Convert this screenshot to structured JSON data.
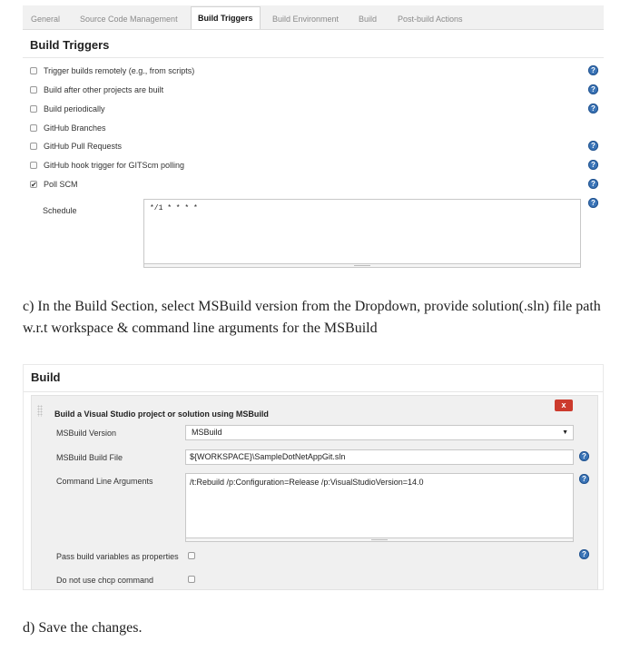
{
  "tabs": [
    "General",
    "Source Code Management",
    "Build Triggers",
    "Build Environment",
    "Build",
    "Post-build Actions"
  ],
  "active_tab": "Build Triggers",
  "build_triggers": {
    "title": "Build Triggers",
    "options": [
      {
        "label": "Trigger builds remotely (e.g., from scripts)",
        "checked": false,
        "help": true
      },
      {
        "label": "Build after other projects are built",
        "checked": false,
        "help": true
      },
      {
        "label": "Build periodically",
        "checked": false,
        "help": true
      },
      {
        "label": "GitHub Branches",
        "checked": false,
        "help": false
      },
      {
        "label": "GitHub Pull Requests",
        "checked": false,
        "help": true
      },
      {
        "label": "GitHub hook trigger for GITScm polling",
        "checked": false,
        "help": true
      },
      {
        "label": "Poll SCM",
        "checked": true,
        "help": true
      }
    ],
    "schedule_label": "Schedule",
    "schedule_value": "*/1 * * * *"
  },
  "para_c": "c) In the Build Section, select MSBuild version from the Dropdown, provide solution(.sln) file path w.r.t workspace & command line arguments for the MSBuild",
  "build": {
    "title": "Build",
    "step_title": "Build a Visual Studio project or solution using MSBuild",
    "close_label": "x",
    "msbuild_version_label": "MSBuild Version",
    "msbuild_version_value": "MSBuild",
    "build_file_label": "MSBuild Build File",
    "build_file_value": "${WORKSPACE}\\SampleDotNetAppGit.sln",
    "cmd_args_label": "Command Line Arguments",
    "cmd_args_value": "/t:Rebuild /p:Configuration=Release /p:VisualStudioVersion=14.0",
    "pass_vars_label": "Pass build variables as properties",
    "pass_vars_checked": false,
    "no_chcp_label": "Do not use chcp command",
    "no_chcp_checked": false
  },
  "para_d": "d) Save the changes.",
  "colors": {
    "help_icon": "#3a74b7",
    "close_button": "#cc3b2d",
    "panel_bg": "#f0f0f0"
  }
}
